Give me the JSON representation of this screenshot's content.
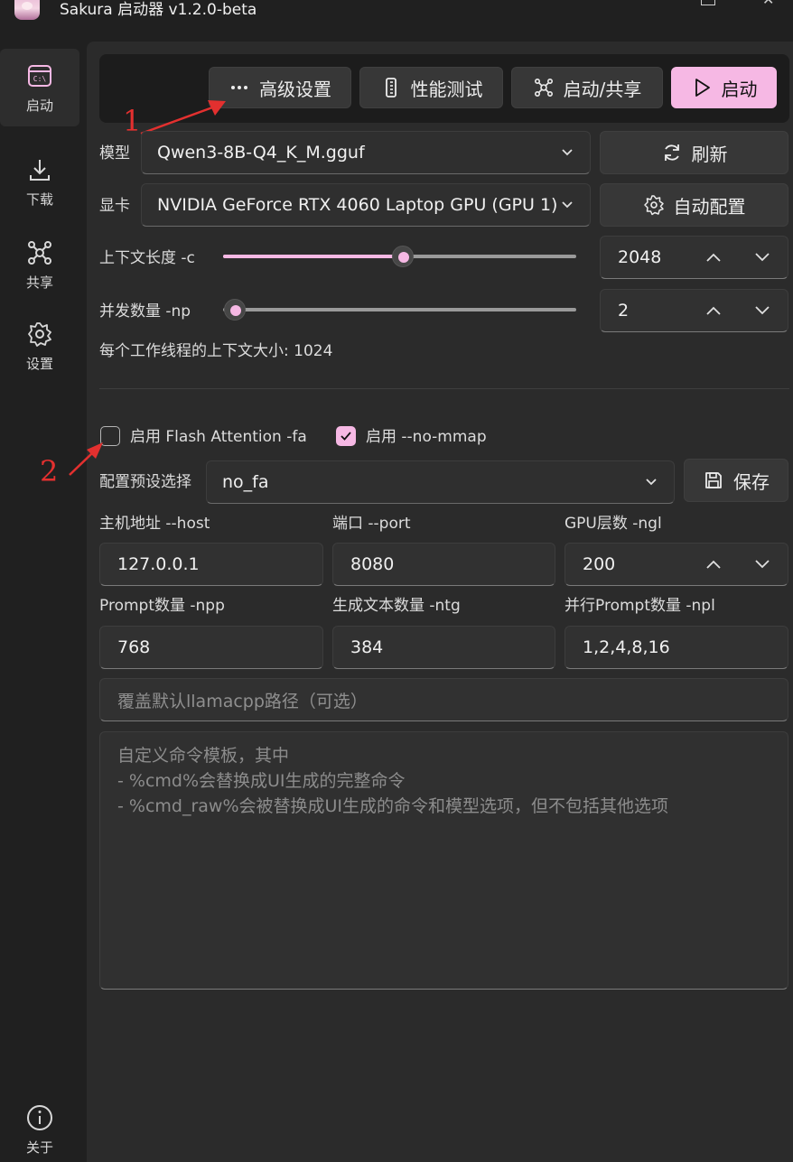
{
  "window": {
    "title": "Sakura 启动器 v1.2.0-beta"
  },
  "sidebar": {
    "items": [
      {
        "label": "启动",
        "icon": "terminal-icon"
      },
      {
        "label": "下载",
        "icon": "download-icon"
      },
      {
        "label": "共享",
        "icon": "share-network-icon"
      },
      {
        "label": "设置",
        "icon": "gear-icon"
      }
    ],
    "about": {
      "label": "关于",
      "icon": "info-icon"
    }
  },
  "toolbar": {
    "advanced_label": "高级设置",
    "benchmark_label": "性能测试",
    "launch_share_label": "启动/共享",
    "launch_label": "启动",
    "accent": "#f6b8e4"
  },
  "model": {
    "label": "模型",
    "value": "Qwen3-8B-Q4_K_M.gguf",
    "refresh_label": "刷新"
  },
  "gpu": {
    "label": "显卡",
    "value": "NVIDIA GeForce RTX 4060 Laptop GPU (GPU 1)",
    "auto_config_label": "自动配置"
  },
  "context": {
    "label": "上下文长度 -c",
    "value": "2048",
    "slider_fraction": 0.51
  },
  "parallel": {
    "label": "并发数量 -np",
    "value": "2",
    "slider_fraction": 0.0
  },
  "per_thread_info": "每个工作线程的上下文大小: 1024",
  "flags": {
    "flash_attention": {
      "label": "启用 Flash Attention -fa",
      "checked": false
    },
    "no_mmap": {
      "label": "启用 --no-mmap",
      "checked": true
    }
  },
  "preset": {
    "label": "配置预设选择",
    "value": "no_fa",
    "save_label": "保存"
  },
  "host": {
    "label": "主机地址 --host",
    "value": "127.0.0.1"
  },
  "port": {
    "label": "端口 --port",
    "value": "8080"
  },
  "ngl": {
    "label": "GPU层数 -ngl",
    "value": "200"
  },
  "npp": {
    "label": "Prompt数量 -npp",
    "value": "768"
  },
  "ntg": {
    "label": "生成文本数量 -ntg",
    "value": "384"
  },
  "npl": {
    "label": "并行Prompt数量 -npl",
    "value": "1,2,4,8,16"
  },
  "llamacpp_path": {
    "placeholder": "覆盖默认llamacpp路径（可选）"
  },
  "command_template": {
    "placeholder_lines": [
      "自定义命令模板，其中",
      "- %cmd%会替换成UI生成的完整命令",
      "- %cmd_raw%会被替换成UI生成的命令和模型选项，但不包括其他选项"
    ]
  },
  "annotations": {
    "one": "1",
    "two": "2",
    "color": "#e3302f"
  }
}
